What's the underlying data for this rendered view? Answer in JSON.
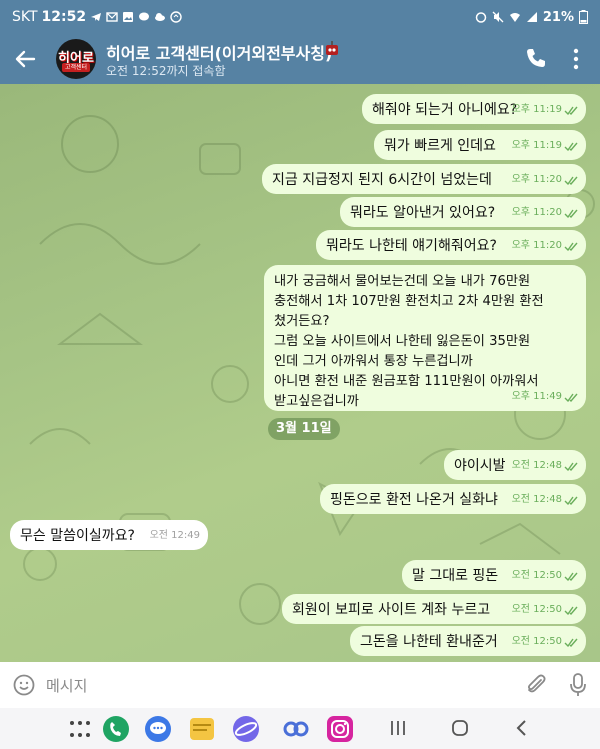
{
  "status_bar": {
    "carrier": "SKT",
    "time": "12:52",
    "battery": "21%"
  },
  "header": {
    "title": "히어로 고객센터(이거외전부사칭)",
    "subtitle": "오전 12:52까지 접속함",
    "avatar_top": "히어로",
    "avatar_bottom": "고객센터"
  },
  "messages": [
    {
      "text": "해줘야 되는거 아니에요?",
      "time": "오후 11:19",
      "dir": "out"
    },
    {
      "text": "뭐가 빠르게 인데요",
      "time": "오후 11:19",
      "dir": "out"
    },
    {
      "text": "지금 지급정지 된지 6시간이 넘었는데",
      "time": "오후 11:20",
      "dir": "out"
    },
    {
      "text": "뭐라도 알아낸거 있어요?",
      "time": "오후 11:20",
      "dir": "out"
    },
    {
      "text": "뭐라도 나한테 얘기해줘어요?",
      "time": "오후 11:20",
      "dir": "out"
    },
    {
      "text": "내가 궁금해서 물어보는건데 오늘 내가 76만원\n충전해서 1차 107만원 환전치고 2차 4만원 환전\n쳤거든요?\n그럼 오늘 사이트에서 나한테 잃은돈이 35만원\n인데 그거 아까워서 통장 누른겁니까\n아니면 환전 내준 원금포함 111만원이 아까워서\n받고싶은겁니까",
      "time": "오후 11:49",
      "dir": "out"
    },
    {
      "text": "야이시발",
      "time": "오전 12:48",
      "dir": "out"
    },
    {
      "text": "핑돈으로 환전 나온거 실화냐",
      "time": "오전 12:48",
      "dir": "out"
    },
    {
      "text": "무슨 말씀이실까요?",
      "time": "오전 12:49",
      "dir": "in"
    },
    {
      "text": "말 그대로 핑돈",
      "time": "오전 12:50",
      "dir": "out"
    },
    {
      "text": "회원이 보피로 사이트 계좌 누르고",
      "time": "오전 12:50",
      "dir": "out"
    },
    {
      "text": "그돈을 나한테 환내준거",
      "time": "오전 12:50",
      "dir": "out"
    }
  ],
  "date_divider": "3월 11일",
  "input": {
    "placeholder": "메시지"
  },
  "colors": {
    "header": "#5682a3",
    "outgoing_bubble": "#effdde",
    "incoming_bubble": "#ffffff",
    "check": "#6aae5b"
  }
}
